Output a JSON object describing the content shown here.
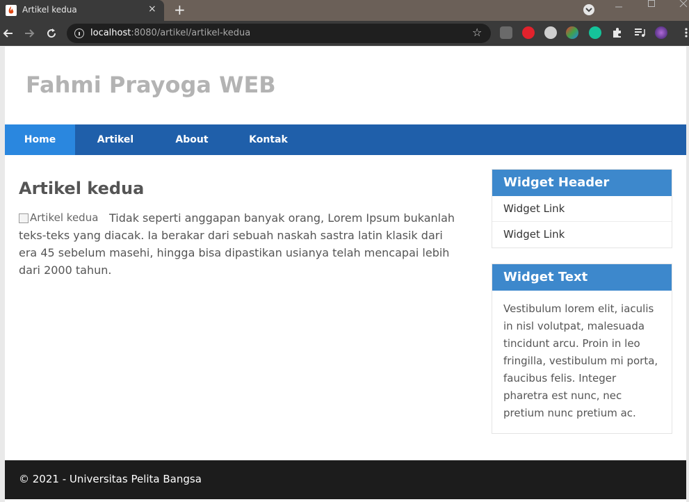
{
  "browser": {
    "tab_title": "Artikel kedua",
    "tab_close": "×",
    "new_tab": "+",
    "url_host": "localhost",
    "url_rest": ":8080/artikel/artikel-kedua",
    "star": "☆"
  },
  "site": {
    "title": "Fahmi Prayoga WEB"
  },
  "nav": {
    "items": [
      {
        "label": "Home",
        "active": true
      },
      {
        "label": "Artikel",
        "active": false
      },
      {
        "label": "About",
        "active": false
      },
      {
        "label": "Kontak",
        "active": false
      }
    ]
  },
  "article": {
    "title": "Artikel kedua",
    "image_alt": "Artikel kedua",
    "body": "Tidak seperti anggapan banyak orang, Lorem Ipsum bukanlah teks-teks yang diacak. Ia berakar dari sebuah naskah sastra latin klasik dari era 45 sebelum masehi, hingga bisa dipastikan usianya telah mencapai lebih dari 2000 tahun."
  },
  "sidebar": {
    "widget_header": {
      "title": "Widget Header",
      "links": [
        "Widget Link",
        "Widget Link"
      ]
    },
    "widget_text": {
      "title": "Widget Text",
      "text": "Vestibulum lorem elit, iaculis in nisl volutpat, malesuada tincidunt arcu. Proin in leo fringilla, vestibulum mi porta, faucibus felis. Integer pharetra est nunc, nec pretium nunc pretium ac."
    }
  },
  "footer": {
    "text": "© 2021 - Universitas Pelita Bangsa"
  },
  "colors": {
    "nav_bg": "#1f5faa",
    "nav_active": "#2a87df",
    "widget_header_bg": "#3d88cc",
    "footer_bg": "#1c1c1c"
  }
}
